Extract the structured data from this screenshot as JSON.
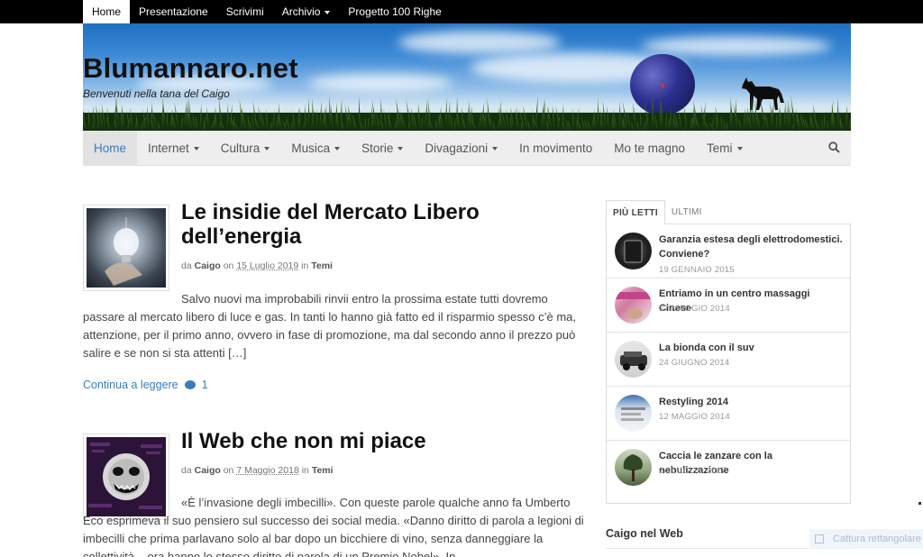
{
  "topbar": {
    "items": [
      {
        "label": "Home",
        "active": true,
        "dropdown": false
      },
      {
        "label": "Presentazione",
        "active": false,
        "dropdown": false
      },
      {
        "label": "Scrivimi",
        "active": false,
        "dropdown": false
      },
      {
        "label": "Archivio",
        "active": false,
        "dropdown": true
      },
      {
        "label": "Progetto 100 Righe",
        "active": false,
        "dropdown": false
      }
    ]
  },
  "header": {
    "site_title": "Blumannaro.net",
    "site_description": "Benvenuti nella tana del Caigo"
  },
  "mainnav": {
    "items": [
      {
        "label": "Home",
        "active": true,
        "dropdown": false
      },
      {
        "label": "Internet",
        "active": false,
        "dropdown": true
      },
      {
        "label": "Cultura",
        "active": false,
        "dropdown": true
      },
      {
        "label": "Musica",
        "active": false,
        "dropdown": true
      },
      {
        "label": "Storie",
        "active": false,
        "dropdown": true
      },
      {
        "label": "Divagazioni",
        "active": false,
        "dropdown": true
      },
      {
        "label": "In movimento",
        "active": false,
        "dropdown": false
      },
      {
        "label": "Mo te magno",
        "active": false,
        "dropdown": false
      },
      {
        "label": "Temi",
        "active": false,
        "dropdown": true
      }
    ],
    "search_icon": "search-icon"
  },
  "posts": [
    {
      "title": "Le insidie del Mercato Libero dell’energia",
      "meta": {
        "by": "da",
        "author": "Caigo",
        "on": "on",
        "date": "15 Luglio 2019",
        "in": "in",
        "category": "Temi"
      },
      "excerpt": "Salvo nuovi ma improbabili rinvii entro la prossima estate tutti dovremo passare al mercato libero di luce e gas. In tanti lo hanno già fatto ed il risparmio spesso c’è ma, attenzione, per il primo anno, ovvero in fase di promozione, ma dal secondo anno il prezzo può salire e se non si sta attenti […]",
      "read_more": "Continua a leggere",
      "comments": "1"
    },
    {
      "title": "Il Web che non mi piace",
      "meta": {
        "by": "da",
        "author": "Caigo",
        "on": "on",
        "date": "7 Maggio 2018",
        "in": "in",
        "category": "Temi"
      },
      "excerpt": "«È l’invasione degli imbecilli». Con queste parole qualche anno fa Umberto Eco esprimeva il suo pensiero sul successo dei social media. «Danno diritto di parola a legioni di imbecilli che prima parlavano solo al bar dopo un bicchiere di vino, senza danneggiare la collettività... ora hanno lo stesso diritto di parola di un Premio Nobel». In"
    }
  ],
  "sidebar": {
    "tabs": [
      {
        "label": "PIÙ LETTI",
        "active": true
      },
      {
        "label": "ULTIMI",
        "active": false
      }
    ],
    "popular": [
      {
        "title": "Garanzia estesa degli elettrodomestici. Conviene?",
        "date": "19 GENNAIO 2015"
      },
      {
        "title": "Entriamo in un centro massaggi Cinese",
        "date": "27 MAGGIO 2014"
      },
      {
        "title": "La bionda con il suv",
        "date": "24 GIUGNO 2014"
      },
      {
        "title": "Restyling 2014",
        "date": "12 MAGGIO 2014"
      },
      {
        "title": "Caccia le zanzare con la nebulizzazione",
        "date": "24 LUGLIO 2017"
      }
    ],
    "widget_title": "Caigo nel Web"
  },
  "overlay": {
    "toast_text": "Cattura rettangolare"
  },
  "colors": {
    "link": "#3a7bbf",
    "topbar_bg": "#000000",
    "nav_bg": "#eeeeee"
  }
}
